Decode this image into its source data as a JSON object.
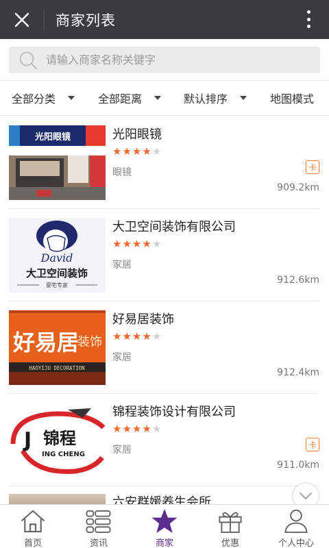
{
  "header": {
    "title": "商家列表"
  },
  "search": {
    "placeholder": "请输入商家名称关键字"
  },
  "filters": [
    {
      "label": "全部分类"
    },
    {
      "label": "全部距离"
    },
    {
      "label": "默认排序"
    },
    {
      "label": "地图模式"
    }
  ],
  "merchants": [
    {
      "name": "光阳眼镜",
      "rating": 4,
      "max_rating": 5,
      "category": "眼镜",
      "distance": "909.2km",
      "badge": "卡",
      "thumb_text": "光阳眼镜"
    },
    {
      "name": "大卫空间装饰有限公司",
      "rating": 4,
      "max_rating": 5,
      "category": "家居",
      "distance": "912.6km",
      "badge": "",
      "thumb_text": "大卫空间装饰",
      "thumb_sub": "豪宅专家",
      "thumb_script": "David"
    },
    {
      "name": "好易居装饰",
      "rating": 4,
      "max_rating": 5,
      "category": "家居",
      "distance": "912.4km",
      "badge": "",
      "thumb_text": "好易居",
      "thumb_text2": "装饰",
      "thumb_sub": "HAOYIJU DECORATION"
    },
    {
      "name": "锦程装饰设计有限公司",
      "rating": 4,
      "max_rating": 5,
      "category": "家居",
      "distance": "911.0km",
      "badge": "卡",
      "thumb_text": "锦程",
      "thumb_sub": "ING CHENG",
      "thumb_letter": "J"
    }
  ],
  "next_item": {
    "name": "六安群媛养生会所"
  },
  "tabbar": [
    {
      "label": "首页",
      "icon": "home-icon",
      "active": false
    },
    {
      "label": "资讯",
      "icon": "news-icon",
      "active": false
    },
    {
      "label": "商家",
      "icon": "star-icon",
      "active": true
    },
    {
      "label": "优惠",
      "icon": "gift-icon",
      "active": false
    },
    {
      "label": "个人中心",
      "icon": "person-icon",
      "active": false
    }
  ],
  "colors": {
    "topbar": "#3a3b3f",
    "star": "#f2672c",
    "accent": "#5b2d8e",
    "badge": "#ef7a34"
  }
}
